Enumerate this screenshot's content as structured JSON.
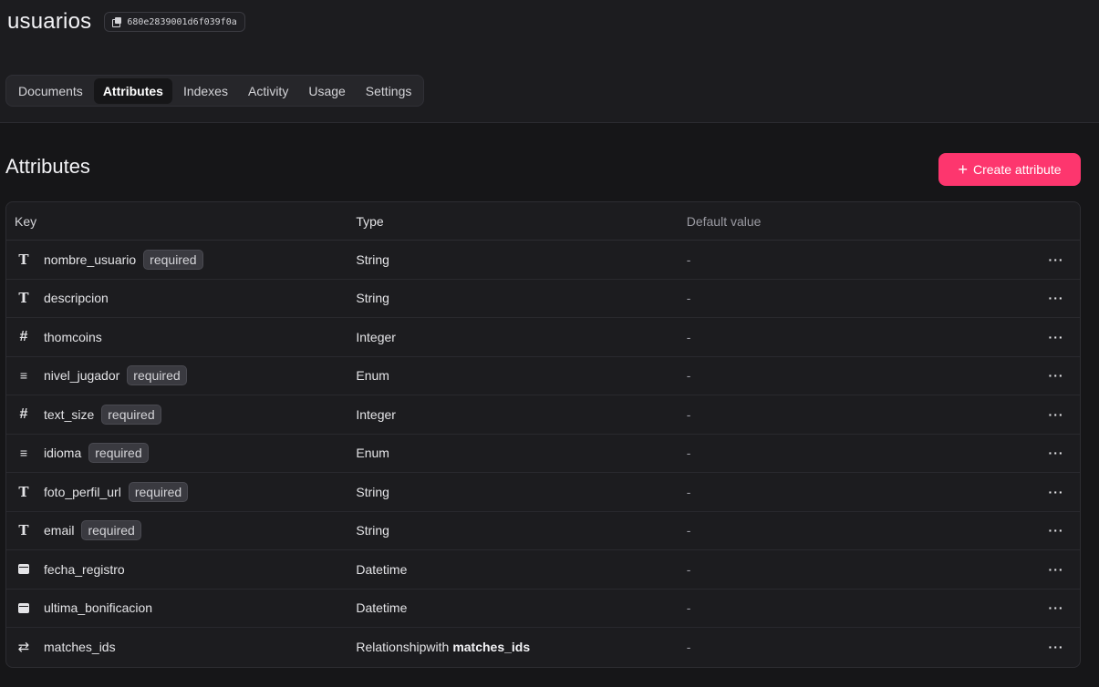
{
  "collection": {
    "name": "usuarios",
    "id": "680e2839001d6f039f0a"
  },
  "tabs": [
    {
      "label": "Documents",
      "active": false
    },
    {
      "label": "Attributes",
      "active": true
    },
    {
      "label": "Indexes",
      "active": false
    },
    {
      "label": "Activity",
      "active": false
    },
    {
      "label": "Usage",
      "active": false
    },
    {
      "label": "Settings",
      "active": false
    }
  ],
  "section": {
    "title": "Attributes",
    "create_label": "Create attribute",
    "accent_color": "#fd366e"
  },
  "table": {
    "headers": {
      "key": "Key",
      "type": "Type",
      "default": "Default value"
    },
    "rows": [
      {
        "icon": "text-icon",
        "key": "nombre_usuario",
        "badge": "required",
        "type": "String",
        "default": "-"
      },
      {
        "icon": "text-icon",
        "key": "descripcion",
        "badge": "",
        "type": "String",
        "default": "-"
      },
      {
        "icon": "hash-icon",
        "key": "thomcoins",
        "badge": "",
        "type": "Integer",
        "default": "-"
      },
      {
        "icon": "list-icon",
        "key": "nivel_jugador",
        "badge": "required",
        "type": "Enum",
        "default": "-"
      },
      {
        "icon": "hash-icon",
        "key": "text_size",
        "badge": "required",
        "type": "Integer",
        "default": "-"
      },
      {
        "icon": "list-icon",
        "key": "idioma",
        "badge": "required",
        "type": "Enum",
        "default": "-"
      },
      {
        "icon": "text-icon",
        "key": "foto_perfil_url",
        "badge": "required",
        "type": "String",
        "default": "-"
      },
      {
        "icon": "text-icon",
        "key": "email",
        "badge": "required",
        "type": "String",
        "default": "-"
      },
      {
        "icon": "calendar-icon",
        "key": "fecha_registro",
        "badge": "",
        "type": "Datetime",
        "default": "-"
      },
      {
        "icon": "calendar-icon",
        "key": "ultima_bonificacion",
        "badge": "",
        "type": "Datetime",
        "default": "-"
      },
      {
        "icon": "relationship-icon",
        "key": "matches_ids",
        "badge": "",
        "type": "Relationshipwith",
        "type_target": "matches_ids",
        "default": "-"
      }
    ]
  }
}
